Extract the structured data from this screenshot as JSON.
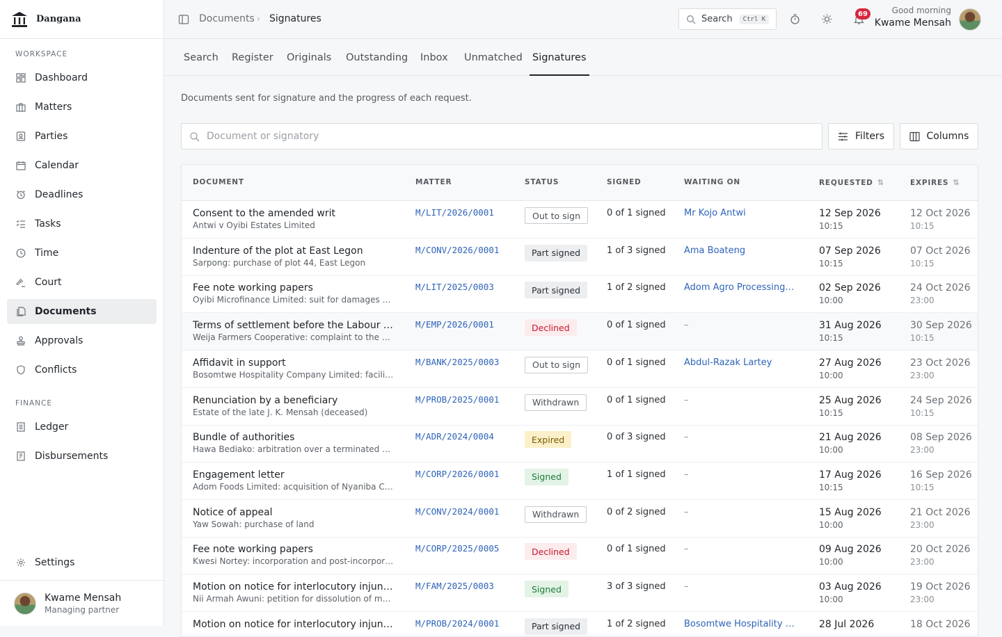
{
  "brand": {
    "name": "Dangana"
  },
  "sidebar": {
    "sections": {
      "workspace": "WORKSPACE",
      "finance": "FINANCE"
    },
    "items": [
      {
        "label": "Dashboard",
        "icon": "dashboard-icon"
      },
      {
        "label": "Matters",
        "icon": "briefcase-icon"
      },
      {
        "label": "Parties",
        "icon": "contact-card-icon"
      },
      {
        "label": "Calendar",
        "icon": "calendar-icon"
      },
      {
        "label": "Deadlines",
        "icon": "alarm-clock-icon"
      },
      {
        "label": "Tasks",
        "icon": "task-list-icon"
      },
      {
        "label": "Time",
        "icon": "clock-icon"
      },
      {
        "label": "Court",
        "icon": "gavel-icon"
      },
      {
        "label": "Documents",
        "icon": "documents-icon",
        "active": true
      },
      {
        "label": "Approvals",
        "icon": "stamp-icon"
      },
      {
        "label": "Conflicts",
        "icon": "shield-icon"
      }
    ],
    "finance_items": [
      {
        "label": "Ledger",
        "icon": "ledger-icon"
      },
      {
        "label": "Disbursements",
        "icon": "receipt-icon"
      }
    ],
    "settings": "Settings",
    "user": {
      "name": "Kwame Mensah",
      "role": "Managing partner"
    }
  },
  "topbar": {
    "breadcrumb": [
      "Documents",
      "Signatures"
    ],
    "search_label": "Search",
    "search_shortcut": "Ctrl K",
    "notification_count": "69",
    "greeting": "Good morning",
    "user_name": "Kwame Mensah"
  },
  "tabs": [
    "Search",
    "Register",
    "Originals",
    "Outstanding",
    "Inbox",
    "Unmatched",
    "Signatures"
  ],
  "active_tab": "Signatures",
  "page": {
    "subtitle": "Documents sent for signature and the progress of each request.",
    "search_placeholder": "Document or signatory",
    "filters_label": "Filters",
    "columns_label": "Columns"
  },
  "table": {
    "columns": [
      "DOCUMENT",
      "MATTER",
      "STATUS",
      "SIGNED",
      "WAITING ON",
      "REQUESTED",
      "EXPIRES"
    ],
    "rows": [
      {
        "title": "Consent to the amended writ",
        "subtitle": "Antwi v Oyibi Estates Limited",
        "matter": "M/LIT/2026/0001",
        "status": "Out to sign",
        "status_kind": "outline",
        "signed": "0 of 1 signed",
        "waiting": "Mr Kojo Antwi",
        "req_date": "12 Sep 2026",
        "req_time": "10:15",
        "exp_date": "12 Oct 2026",
        "exp_time": "10:15"
      },
      {
        "title": "Indenture of the plot at East Legon",
        "subtitle": "Sarpong: purchase of plot 44, East Legon",
        "matter": "M/CONV/2026/0001",
        "status": "Part signed",
        "status_kind": "part",
        "signed": "1 of 3 signed",
        "waiting": "Ama Boateng",
        "req_date": "07 Sep 2026",
        "req_time": "10:15",
        "exp_date": "07 Oct 2026",
        "exp_time": "10:15"
      },
      {
        "title": "Fee note working papers",
        "subtitle": "Oyibi Microfinance Limited: suit for damages and...",
        "matter": "M/LIT/2025/0003",
        "status": "Part signed",
        "status_kind": "part",
        "signed": "1 of 2 signed",
        "waiting": "Adom Agro Processing L...",
        "req_date": "02 Sep 2026",
        "req_time": "10:00",
        "exp_date": "24 Oct 2026",
        "exp_time": "23:00"
      },
      {
        "title": "Terms of settlement before the Labour C...",
        "subtitle": "Weija Farmers Cooperative: complaint to the Lab...",
        "matter": "M/EMP/2026/0001",
        "status": "Declined",
        "status_kind": "declined",
        "signed": "0 of 1 signed",
        "waiting": "–",
        "req_date": "31 Aug 2026",
        "req_time": "10:15",
        "exp_date": "30 Sep 2026",
        "exp_time": "10:15"
      },
      {
        "title": "Affidavit in support",
        "subtitle": "Bosomtwe Hospitality Company Limited: facility a...",
        "matter": "M/BANK/2025/0003",
        "status": "Out to sign",
        "status_kind": "outline",
        "signed": "0 of 1 signed",
        "waiting": "Abdul-Razak Lartey",
        "req_date": "27 Aug 2026",
        "req_time": "10:00",
        "exp_date": "23 Oct 2026",
        "exp_time": "23:00"
      },
      {
        "title": "Renunciation by a beneficiary",
        "subtitle": "Estate of the late J. K. Mensah (deceased)",
        "matter": "M/PROB/2025/0001",
        "status": "Withdrawn",
        "status_kind": "outline",
        "signed": "0 of 1 signed",
        "waiting": "–",
        "req_date": "25 Aug 2026",
        "req_time": "10:15",
        "exp_date": "24 Sep 2026",
        "exp_time": "10:15"
      },
      {
        "title": "Bundle of authorities",
        "subtitle": "Hawa Bediako: arbitration over a terminated con...",
        "matter": "M/ADR/2024/0004",
        "status": "Expired",
        "status_kind": "expired",
        "signed": "0 of 3 signed",
        "waiting": "–",
        "req_date": "21 Aug 2026",
        "req_time": "10:00",
        "exp_date": "08 Sep 2026",
        "exp_time": "23:00"
      },
      {
        "title": "Engagement letter",
        "subtitle": "Adom Foods Limited: acquisition of Nyaniba Cold...",
        "matter": "M/CORP/2026/0001",
        "status": "Signed",
        "status_kind": "signed",
        "signed": "1 of 1 signed",
        "waiting": "–",
        "req_date": "17 Aug 2026",
        "req_time": "10:15",
        "exp_date": "16 Sep 2026",
        "exp_time": "10:15"
      },
      {
        "title": "Notice of appeal",
        "subtitle": "Yaw Sowah: purchase of land",
        "matter": "M/CONV/2024/0001",
        "status": "Withdrawn",
        "status_kind": "outline",
        "signed": "0 of 2 signed",
        "waiting": "–",
        "req_date": "15 Aug 2026",
        "req_time": "10:00",
        "exp_date": "21 Oct 2026",
        "exp_time": "23:00"
      },
      {
        "title": "Fee note working papers",
        "subtitle": "Kwesi Nortey: incorporation and post-incorporati...",
        "matter": "M/CORP/2025/0005",
        "status": "Declined",
        "status_kind": "declined",
        "signed": "0 of 1 signed",
        "waiting": "–",
        "req_date": "09 Aug 2026",
        "req_time": "10:00",
        "exp_date": "20 Oct 2026",
        "exp_time": "23:00"
      },
      {
        "title": "Motion on notice for interlocutory injunc...",
        "subtitle": "Nii Armah Awuni: petition for dissolution of marri...",
        "matter": "M/FAM/2025/0003",
        "status": "Signed",
        "status_kind": "signed",
        "signed": "3 of 3 signed",
        "waiting": "–",
        "req_date": "03 Aug 2026",
        "req_time": "10:00",
        "exp_date": "19 Oct 2026",
        "exp_time": "23:00"
      },
      {
        "title": "Motion on notice for interlocutory injunc...",
        "subtitle": "",
        "matter": "M/PROB/2024/0001",
        "status": "Part signed",
        "status_kind": "part",
        "signed": "1 of 2 signed",
        "waiting": "Bosomtwe Hospitality C...",
        "req_date": "28 Jul 2026",
        "req_time": "",
        "exp_date": "18 Oct 2026",
        "exp_time": ""
      }
    ]
  }
}
